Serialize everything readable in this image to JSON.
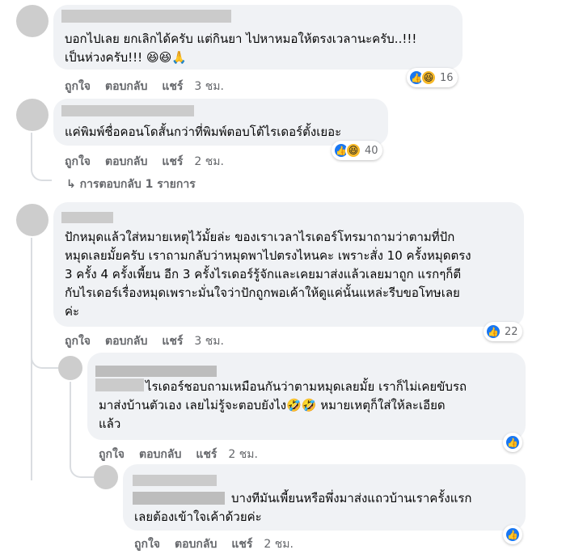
{
  "comments": [
    {
      "text": "บอกไปเลย ยกเลิกได้ครับ แต่กินยา ไปหาหมอให้ตรงเวลานะครับ..!!!\nเป็นห่วงครับ!!! 😆😆🙏",
      "like": "ถูกใจ",
      "reply": "ตอบกลับ",
      "share": "แชร์",
      "time": "3 ชม.",
      "reactions": [
        "like-icon",
        "haha-icon"
      ],
      "reaction_count": "16"
    },
    {
      "text": "แค่พิมพ์ชื่อคอนโดสั้นกว่าที่พิมพ์ตอบโต้ไรเดอร์ตั้งเยอะ",
      "like": "ถูกใจ",
      "reply": "ตอบกลับ",
      "share": "แชร์",
      "time": "2 ชม.",
      "reactions": [
        "like-icon",
        "haha-icon"
      ],
      "reaction_count": "40",
      "replies_link": "↳ การตอบกลับ 1 รายการ"
    },
    {
      "text": "ปักหมุดแล้วใส่หมายเหตุไว้มั้ยล่ะ ของเราเวลาไรเดอร์โทรมาถามว่าตามที่ปัก\nหมุดเลยมั้ยครับ เราถามกลับว่าหมุดพาไปตรงไหนคะ เพราะสั่ง 10 ครั้งหมุดตรง\n3 ครั้ง 4 ครั้งเพี้ยน อีก 3 ครั้งไรเดอร์รู้จักและเคยมาส่งแล้วเลยมาถูก แรกๆก็ตี\nกับไรเดอร์เรื่องหมุดเพราะมั่นใจว่าปักถูกพอเค้าให้ดูแค่นั้นแหล่ะรีบขอโทษเลย\nค่ะ",
      "like": "ถูกใจ",
      "reply": "ตอบกลับ",
      "share": "แชร์",
      "time": "3 ชม.",
      "reactions": [
        "like-icon"
      ],
      "reaction_count": "22"
    },
    {
      "text": "ไรเดอร์ชอบถามเหมือนกันว่าตามหมุดเลยมั้ย เราก็ไม่เคยขับรถ\nมาส่งบ้านตัวเอง เลยไม่รู้จะตอบยังไง🤣🤣 หมายเหตุก็ใส่ให้ละเอียด\nแล้ว",
      "like": "ถูกใจ",
      "reply": "ตอบกลับ",
      "share": "แชร์",
      "time": "2 ชม.",
      "reactions": [
        "like-icon"
      ],
      "reaction_count": ""
    },
    {
      "text": "บางทีมันเพี้ยนหรือพึ่งมาส่งแถวบ้านเราครั้งแรก\nเลยต้องเข้าใจเค้าด้วยค่ะ",
      "like": "ถูกใจ",
      "reply": "ตอบกลับ",
      "share": "แชร์",
      "time": "2 ชม.",
      "reactions": [
        "like-icon"
      ],
      "reaction_count": ""
    }
  ],
  "colors": {
    "bubble": "#f0f2f5",
    "like_blue": "#1877f2",
    "haha_yellow": "#f7b928",
    "meta_text": "#65676b"
  }
}
